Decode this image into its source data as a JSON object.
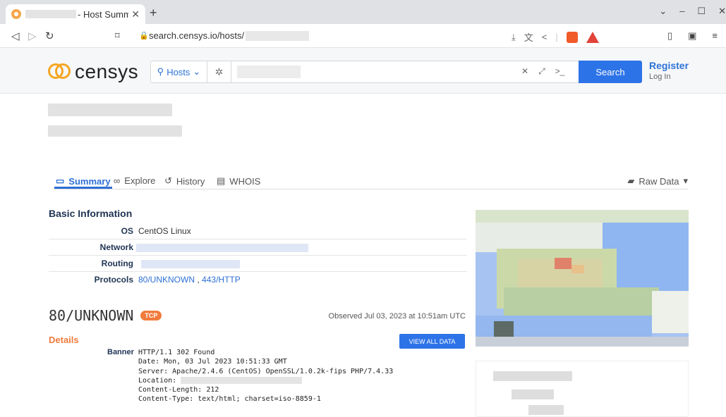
{
  "browser": {
    "tab_title": "- Host Summ",
    "url_text": "search.censys.io/hosts/",
    "window_controls": [
      "⌄",
      "–",
      "☐",
      "✕"
    ]
  },
  "header": {
    "logo_text": "censys",
    "scope_label": "Hosts",
    "search_button": "Search",
    "register": "Register",
    "login": "Log In"
  },
  "tabs": [
    {
      "label": "Summary",
      "icon": "monitor-icon"
    },
    {
      "label": "Explore",
      "icon": "binoculars-icon"
    },
    {
      "label": "History",
      "icon": "history-icon"
    },
    {
      "label": "WHOIS",
      "icon": "document-icon"
    }
  ],
  "raw_data_label": "Raw Data",
  "basic": {
    "title": "Basic Information",
    "os_key": "OS",
    "os_value": "CentOS Linux",
    "network_key": "Network",
    "routing_key": "Routing",
    "protocols_key": "Protocols",
    "protocols": [
      "80/UNKNOWN",
      "443/HTTP"
    ]
  },
  "service": {
    "name": "80/UNKNOWN",
    "transport": "TCP",
    "observed": "Observed Jul 03, 2023 at 10:51am UTC",
    "details_title": "Details",
    "view_all": "VIEW ALL DATA",
    "banner_key": "Banner",
    "banner_lines": [
      "HTTP/1.1 302 Found",
      "Date: Mon, 03 Jul 2023 10:51:33 GMT",
      "Server: Apache/2.4.6 (CentOS) OpenSSL/1.0.2k-fips PHP/7.4.33",
      "Location:",
      "Content-Length: 212",
      "Content-Type: text/html; charset=iso-8859-1"
    ]
  },
  "colors": {
    "accent": "#2d73e8",
    "brand_orange": "#f5a623",
    "badge_orange": "#f07b3c",
    "heading_navy": "#1f3454"
  }
}
